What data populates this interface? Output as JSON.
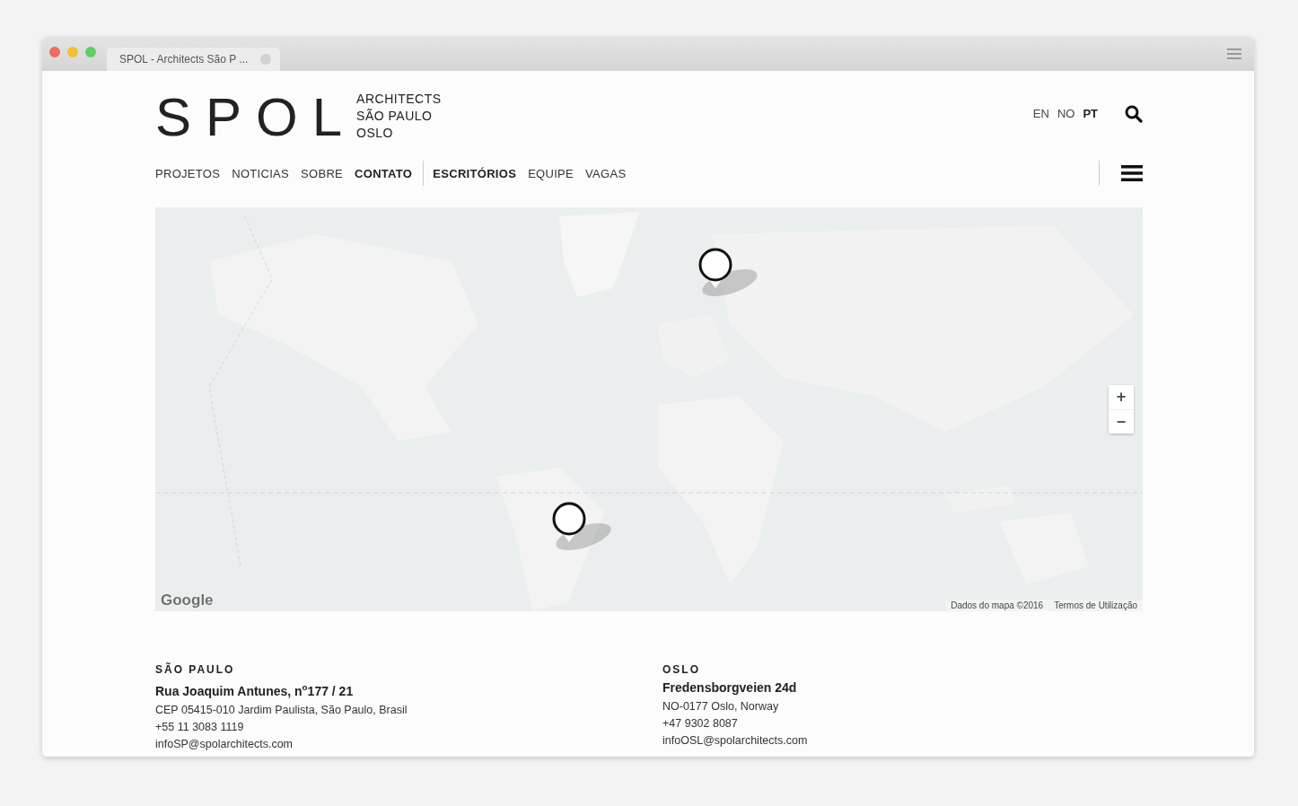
{
  "window": {
    "tab_title": "SPOL - Architects São P ..."
  },
  "logo": {
    "wordmark": "SPOL",
    "lines": [
      "ARCHITECTS",
      "SÃO PAULO",
      "OSLO"
    ]
  },
  "languages": [
    {
      "label": "EN",
      "selected": false
    },
    {
      "label": "NO",
      "selected": false
    },
    {
      "label": "PT",
      "selected": true
    }
  ],
  "nav": {
    "primary": [
      {
        "label": "PROJETOS",
        "selected": false
      },
      {
        "label": "NOTICIAS",
        "selected": false
      },
      {
        "label": "SOBRE",
        "selected": false
      },
      {
        "label": "CONTATO",
        "selected": true
      }
    ],
    "secondary": [
      {
        "label": "ESCRITÓRIOS",
        "selected": true
      },
      {
        "label": "EQUIPE",
        "selected": false
      },
      {
        "label": "VAGAS",
        "selected": false
      }
    ]
  },
  "map": {
    "kind": "picture",
    "logo": "Google",
    "zoom_in": "+",
    "zoom_out": "−",
    "attribution": "Dados do mapa ©2016",
    "terms": "Termos de Utilização"
  },
  "offices": [
    {
      "city": "SÃO PAULO",
      "street": "Rua Joaquim Antunes, n$^{o}$177 / 21",
      "address": "CEP 05415-010 Jardim Paulista, São Paulo, Brasil",
      "phone": "+55 11 3083 1119",
      "email": "infoSP@spolarchitects.com"
    },
    {
      "city": "OSLO",
      "street": "Fredensborgveien 24d",
      "address": "NO-0177 Oslo, Norway",
      "phone": "+47 9302 8087",
      "email": "infoOSL@spolarchitects.com"
    }
  ]
}
